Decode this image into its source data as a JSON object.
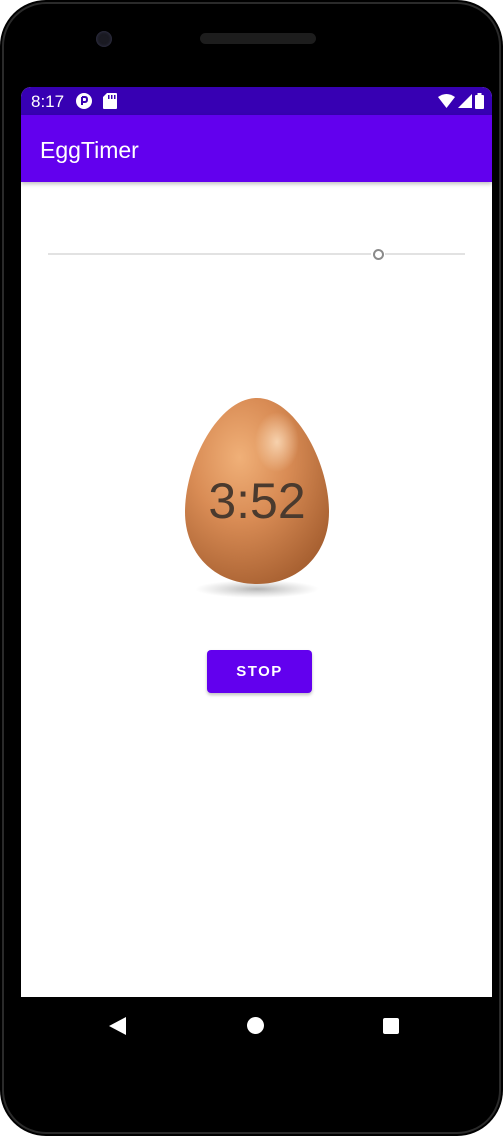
{
  "status_bar": {
    "time": "8:17",
    "left_icons": [
      "play-protect-icon",
      "sd-card-icon"
    ],
    "right_icons": [
      "wifi-icon",
      "cell-signal-icon",
      "battery-icon"
    ]
  },
  "app_bar": {
    "title": "EggTimer"
  },
  "timer": {
    "remaining": "3:52",
    "slider_level": 0.78
  },
  "actions": {
    "stop_label": "STOP"
  },
  "nav_bar": {
    "icons": [
      "back-icon",
      "home-icon",
      "recents-icon"
    ]
  },
  "colors": {
    "status_bar": "#3700b3",
    "app_bar": "#6200ee",
    "button": "#6200ee",
    "egg_text": "#4a3a2e"
  }
}
